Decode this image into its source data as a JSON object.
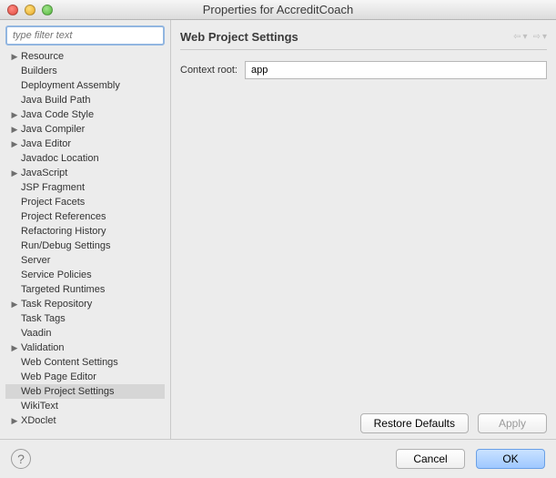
{
  "window": {
    "title": "Properties for AccreditCoach"
  },
  "filter": {
    "placeholder": "type filter text"
  },
  "tree": [
    {
      "label": "Resource",
      "expandable": true
    },
    {
      "label": "Builders",
      "expandable": false
    },
    {
      "label": "Deployment Assembly",
      "expandable": false
    },
    {
      "label": "Java Build Path",
      "expandable": false
    },
    {
      "label": "Java Code Style",
      "expandable": true
    },
    {
      "label": "Java Compiler",
      "expandable": true
    },
    {
      "label": "Java Editor",
      "expandable": true
    },
    {
      "label": "Javadoc Location",
      "expandable": false
    },
    {
      "label": "JavaScript",
      "expandable": true
    },
    {
      "label": "JSP Fragment",
      "expandable": false
    },
    {
      "label": "Project Facets",
      "expandable": false
    },
    {
      "label": "Project References",
      "expandable": false
    },
    {
      "label": "Refactoring History",
      "expandable": false
    },
    {
      "label": "Run/Debug Settings",
      "expandable": false
    },
    {
      "label": "Server",
      "expandable": false
    },
    {
      "label": "Service Policies",
      "expandable": false
    },
    {
      "label": "Targeted Runtimes",
      "expandable": false
    },
    {
      "label": "Task Repository",
      "expandable": true
    },
    {
      "label": "Task Tags",
      "expandable": false
    },
    {
      "label": "Vaadin",
      "expandable": false
    },
    {
      "label": "Validation",
      "expandable": true
    },
    {
      "label": "Web Content Settings",
      "expandable": false
    },
    {
      "label": "Web Page Editor",
      "expandable": false
    },
    {
      "label": "Web Project Settings",
      "expandable": false,
      "selected": true
    },
    {
      "label": "WikiText",
      "expandable": false
    },
    {
      "label": "XDoclet",
      "expandable": true
    }
  ],
  "page": {
    "heading": "Web Project Settings",
    "field_label": "Context root:",
    "field_value": "app"
  },
  "buttons": {
    "restore": "Restore Defaults",
    "apply": "Apply",
    "cancel": "Cancel",
    "ok": "OK"
  }
}
